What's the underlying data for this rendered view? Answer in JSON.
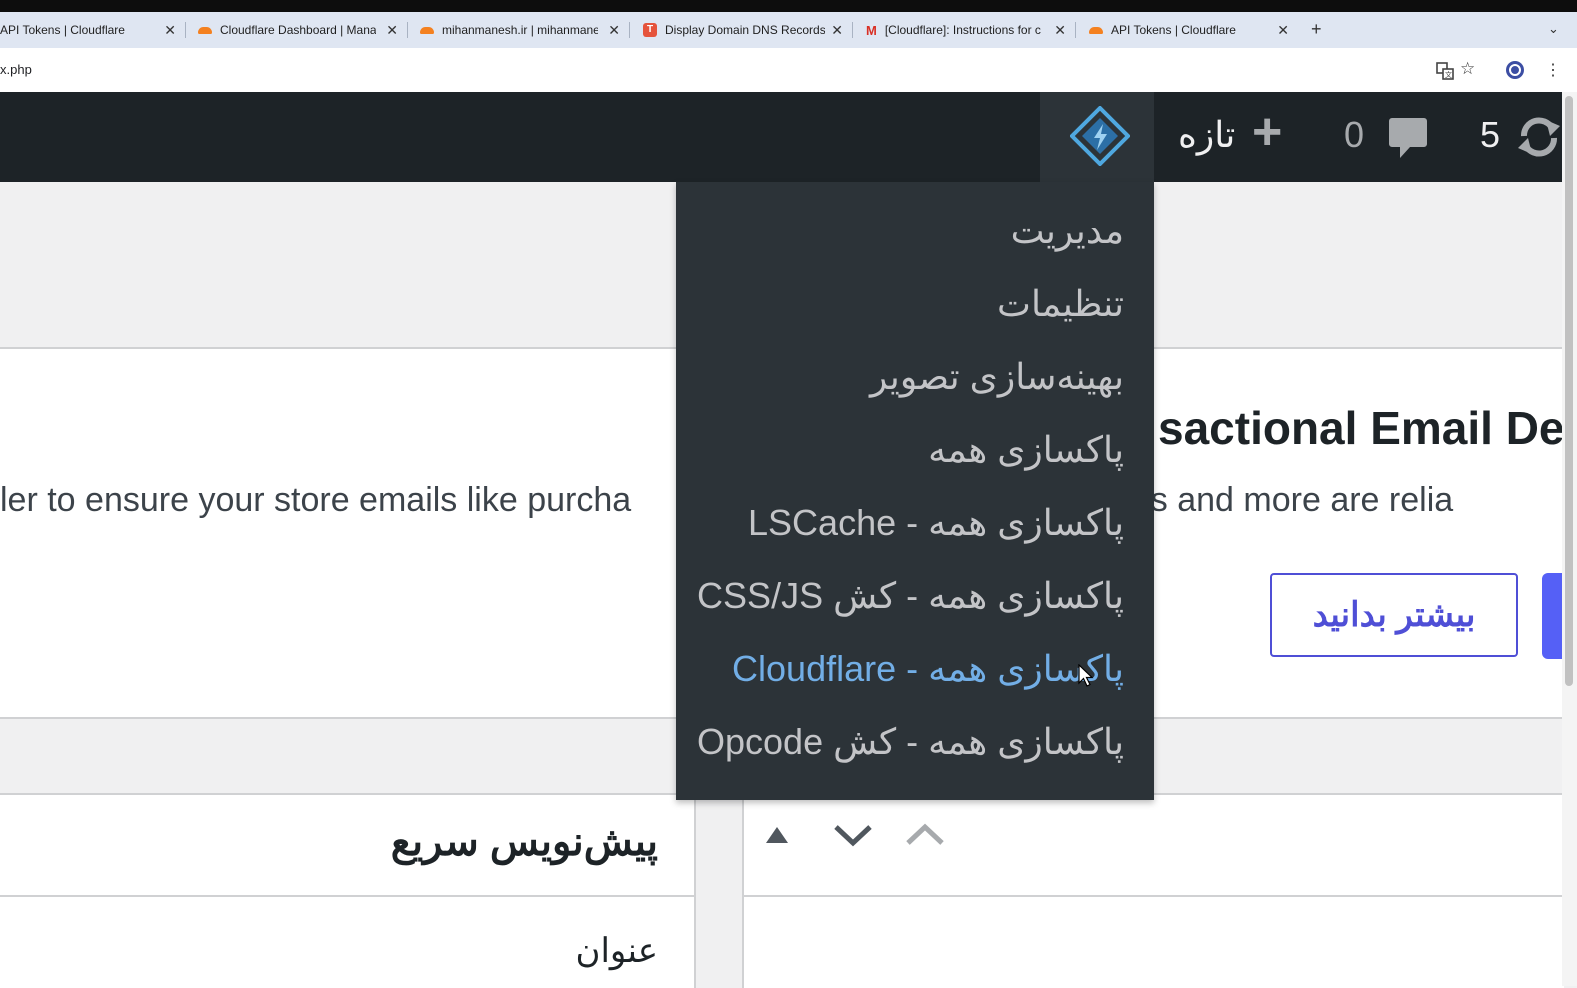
{
  "browser": {
    "tabs": [
      {
        "title": "API Tokens | Cloudflare",
        "icon": "cloudflare"
      },
      {
        "title": "Cloudflare Dashboard | Manag",
        "icon": "cloudflare"
      },
      {
        "title": "mihanmanesh.ir | mihanmanesh",
        "icon": "cloudflare"
      },
      {
        "title": "Display Domain DNS Records",
        "icon": "t-logo"
      },
      {
        "title": "[Cloudflare]: Instructions for c",
        "icon": "gmail"
      },
      {
        "title": "API Tokens | Cloudflare",
        "icon": "cloudflare"
      }
    ],
    "new_tab_symbol": "+",
    "url": "x.php"
  },
  "adminbar": {
    "new_label": "تازه",
    "new_symbol": "+",
    "comments_count": "0",
    "updates_count": "5"
  },
  "dropdown": {
    "items": [
      "مدیریت",
      "تنظیمات",
      "بهینه‌سازی تصویر",
      "پاکسازی همه",
      "پاکسازی همه - LSCache",
      "پاکسازی همه - کش CSS/JS",
      "پاکسازی همه - Cloudflare",
      "پاکسازی همه - کش Opcode"
    ],
    "hovered_index": 6
  },
  "notice": {
    "title": "sactional Email Del",
    "text": "ler to ensure your store emails like purcha                                              pdates and more are relia",
    "learn_more": "بیشتر بدانید"
  },
  "quick_draft": {
    "title": "پیش‌نویس سریع",
    "title_field_label": "عنوان"
  },
  "colors": {
    "adminbar_bg": "#1d2327",
    "dropdown_bg": "#2c3338",
    "menu_text": "#c3c4c7",
    "menu_hover": "#72aee6",
    "accent": "#4f4fd6"
  }
}
